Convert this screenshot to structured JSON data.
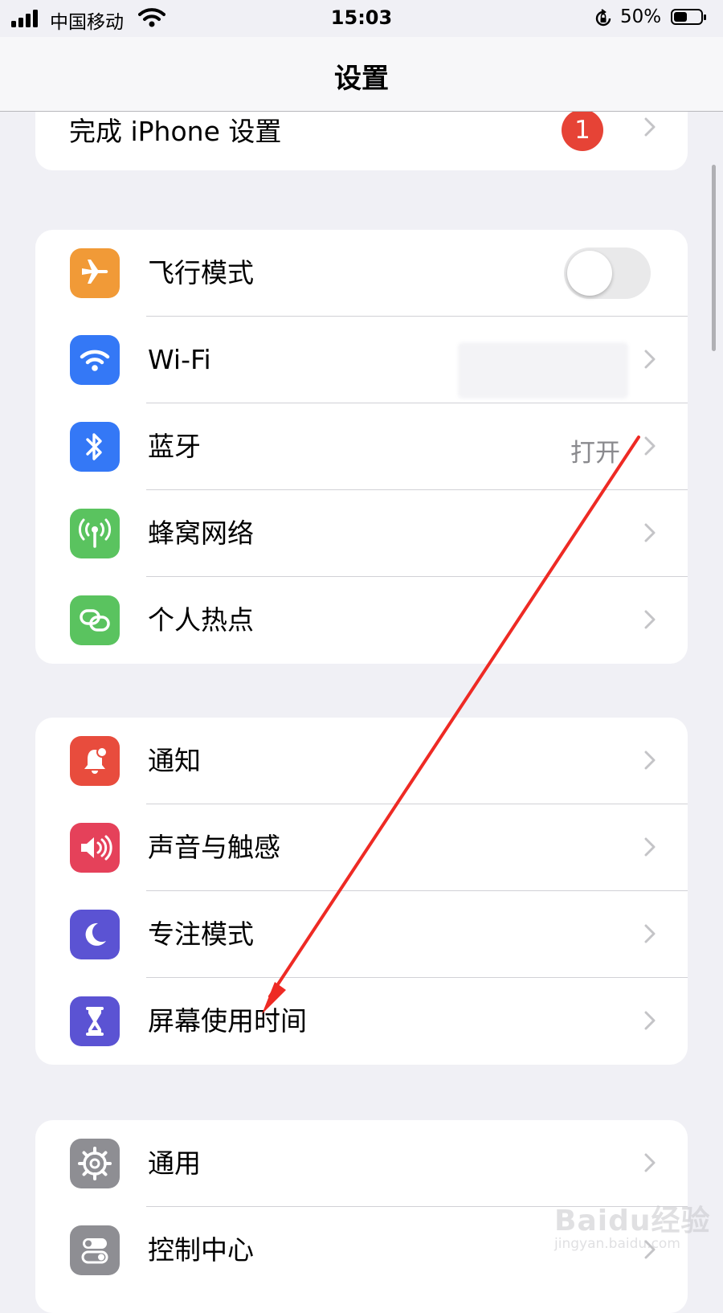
{
  "status_bar": {
    "carrier": "中国移动",
    "time": "15:03",
    "battery_percent": "50%",
    "battery_level": 0.5
  },
  "nav": {
    "title": "设置"
  },
  "setup_row": {
    "label": "完成 iPhone 设置",
    "badge": "1"
  },
  "group_connectivity": [
    {
      "label": "飞行模式",
      "icon": "airplane-icon",
      "color": "#f19a37",
      "control": "toggle",
      "toggle_on": false
    },
    {
      "label": "Wi-Fi",
      "icon": "wifi-icon",
      "color": "#3478f6"
    },
    {
      "label": "蓝牙",
      "icon": "bluetooth-icon",
      "color": "#3478f6",
      "value": "打开"
    },
    {
      "label": "蜂窝网络",
      "icon": "cellular-icon",
      "color": "#5ac35f"
    },
    {
      "label": "个人热点",
      "icon": "hotspot-icon",
      "color": "#5ac35f"
    }
  ],
  "group_notifications": [
    {
      "label": "通知",
      "icon": "bell-icon",
      "color": "#e84c3d"
    },
    {
      "label": "声音与触感",
      "icon": "speaker-icon",
      "color": "#e5415a"
    },
    {
      "label": "专注模式",
      "icon": "moon-icon",
      "color": "#5b53d3"
    },
    {
      "label": "屏幕使用时间",
      "icon": "hourglass-icon",
      "color": "#5b53d3"
    }
  ],
  "group_general": [
    {
      "label": "通用",
      "icon": "gear-icon",
      "color": "#8e8e93"
    },
    {
      "label": "控制中心",
      "icon": "switches-icon",
      "color": "#8e8e93"
    }
  ],
  "annotation": {
    "type": "red-arrow",
    "color": "#ee2a24"
  },
  "watermark": {
    "main": "Baidu经验",
    "sub": "jingyan.baidu.com"
  }
}
